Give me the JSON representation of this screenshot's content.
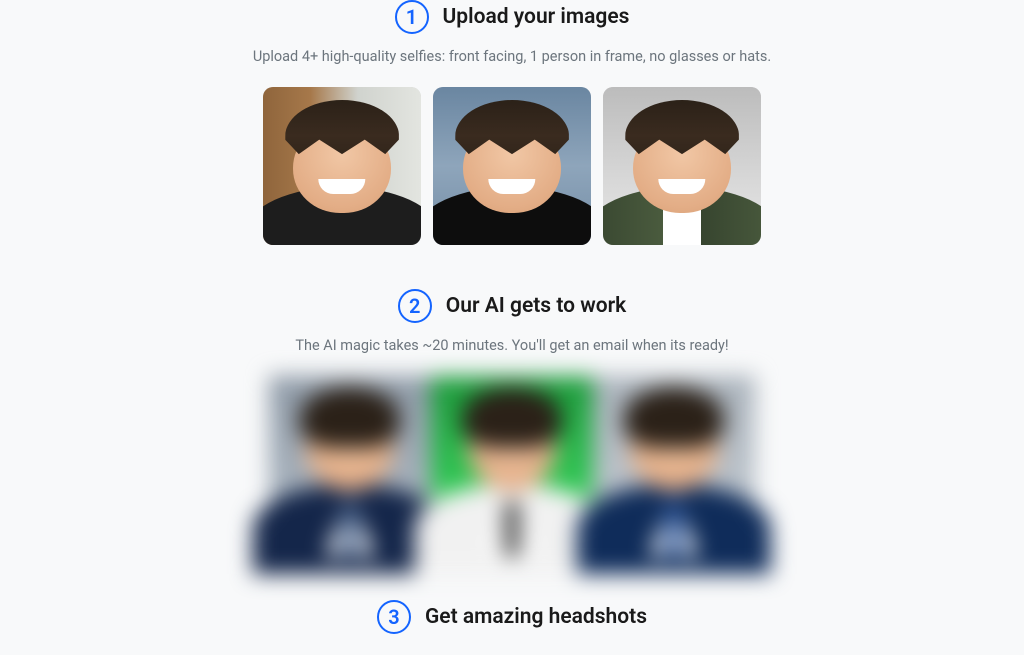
{
  "steps": [
    {
      "number": "1",
      "title": "Upload your images",
      "description": "Upload 4+ high-quality selfies: front facing, 1 person in frame, no glasses or hats."
    },
    {
      "number": "2",
      "title": "Our AI gets to work",
      "description": "The AI magic takes ~20 minutes. You'll get an email when its ready!"
    },
    {
      "number": "3",
      "title": "Get amazing headshots",
      "description": ""
    }
  ]
}
